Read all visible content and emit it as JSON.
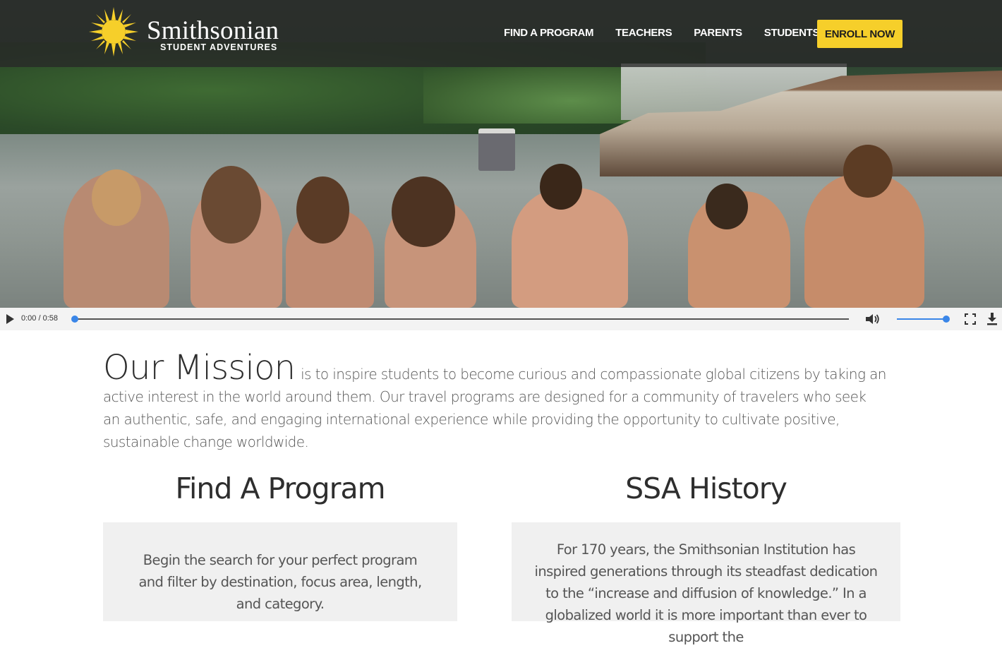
{
  "header": {
    "brand": "Smithsonian",
    "brand_sub": "STUDENT ADVENTURES",
    "nav": [
      "FIND A PROGRAM",
      "TEACHERS",
      "PARENTS",
      "STUDENTS"
    ],
    "enroll_label": "ENROLL NOW",
    "accent_color": "#f6cf2a"
  },
  "video": {
    "time_display": "0:00 / 0:58",
    "progress": 0,
    "volume": 1,
    "accent_color": "#3a86e8"
  },
  "mission": {
    "heading": "Our Mission",
    "text": "is to inspire students to become curious and compassionate global citizens by taking an active interest in the world around them. Our travel programs are designed for a community of travelers who seek an authentic, safe, and engaging international experience while providing the opportunity to cultivate positive, sustainable change worldwide."
  },
  "find_program": {
    "title": "Find A Program",
    "text": "Begin the search for your perfect program and filter by destination, focus area, length, and category."
  },
  "history": {
    "title": "SSA History",
    "text": "For 170 years, the Smithsonian Institution has inspired generations through its steadfast dedication to the “increase and diffusion of knowledge.” In a globalized world it is more important than ever to support the"
  }
}
